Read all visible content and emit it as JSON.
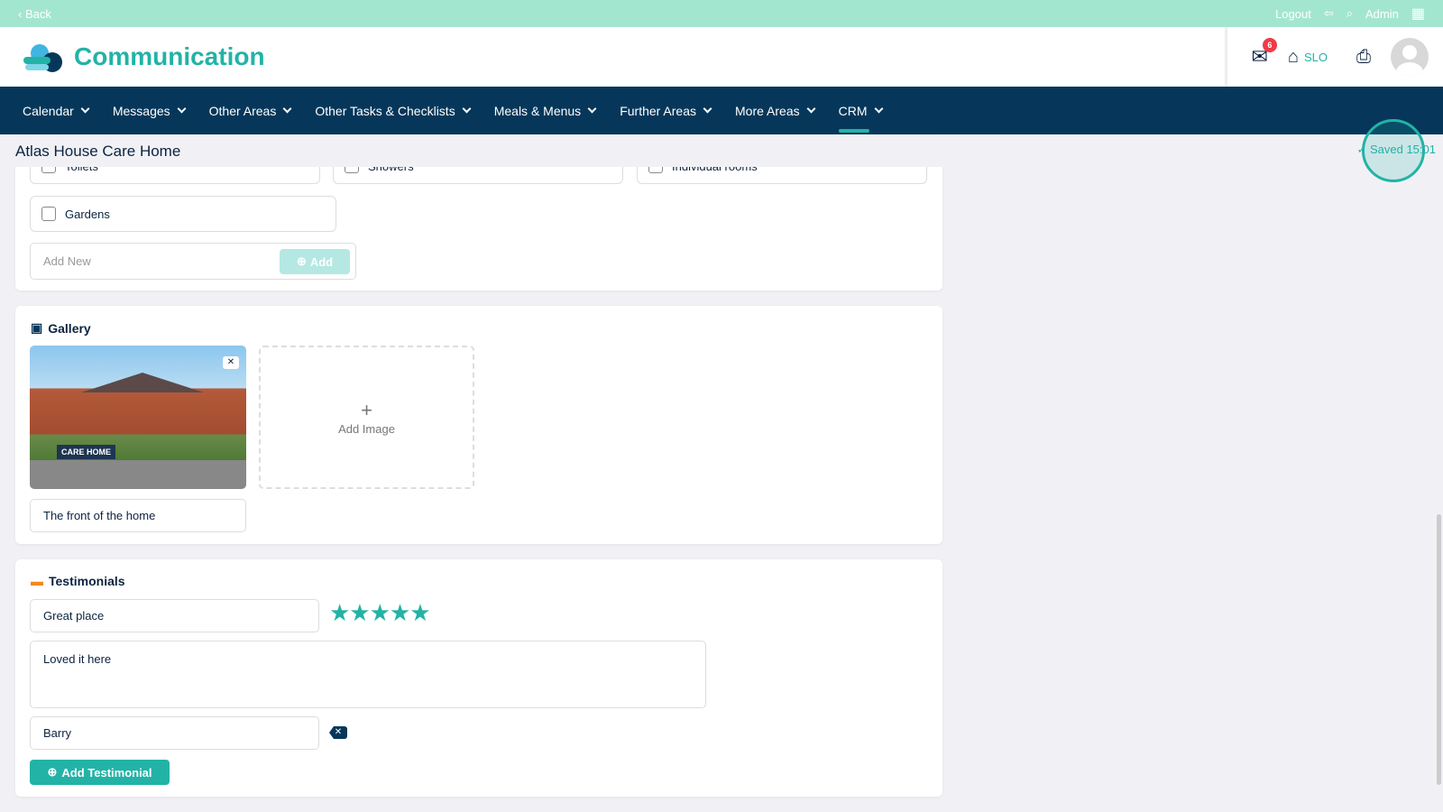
{
  "topbar": {
    "back": "‹ Back",
    "logout": "Logout",
    "user": "Admin"
  },
  "header": {
    "app_title": "Communication",
    "mail_count": "6",
    "home_label": "SLO"
  },
  "nav": [
    {
      "label": "Calendar"
    },
    {
      "label": "Messages"
    },
    {
      "label": "Other Areas"
    },
    {
      "label": "Other Tasks & Checklists"
    },
    {
      "label": "Meals & Menus"
    },
    {
      "label": "Further Areas"
    },
    {
      "label": "More Areas"
    },
    {
      "label": "CRM"
    }
  ],
  "page": {
    "title": "Atlas House Care Home",
    "saved": "Saved 15:01"
  },
  "facilities": {
    "items": [
      "Toilets",
      "Showers",
      "Individual rooms",
      "Gardens"
    ],
    "add_placeholder": "Add New",
    "add_button": "Add"
  },
  "gallery": {
    "title": "Gallery",
    "image_sign": "CARE HOME",
    "caption": "The front of the home",
    "add_image": "Add Image",
    "plus": "+"
  },
  "testimonials": {
    "title": "Testimonials",
    "heading_value": "Great place",
    "rating": 5,
    "stars": "★★★★★",
    "body_value": "Loved it here",
    "author_value": "Barry",
    "add_button": "Add Testimonial"
  },
  "colors": {
    "accent": "#22b3a6",
    "nav": "#06375a",
    "topbar": "#a3e6cf"
  }
}
